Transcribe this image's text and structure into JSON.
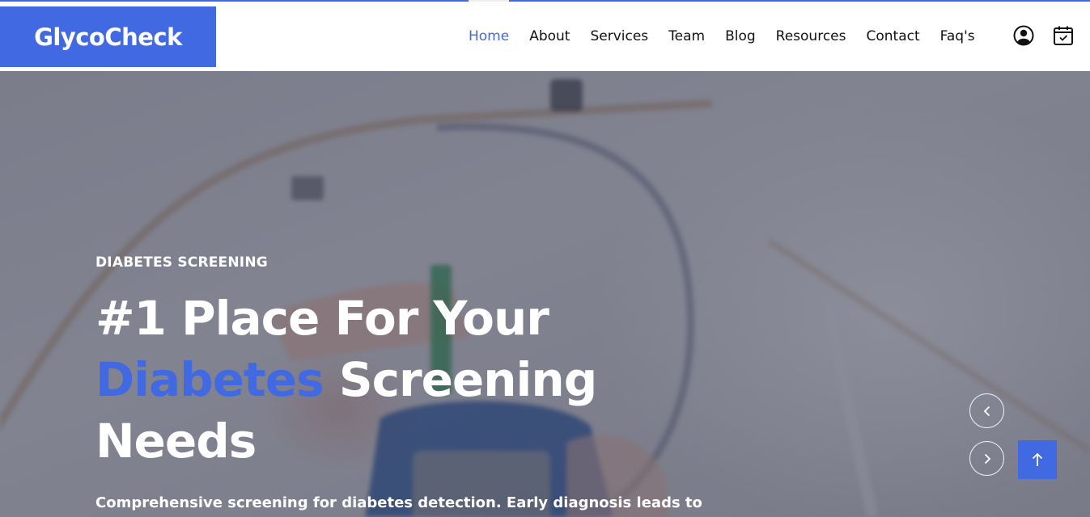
{
  "brand": {
    "name": "GlycoCheck",
    "color": "#4169e1"
  },
  "nav": {
    "items": [
      {
        "label": "Home",
        "active": true
      },
      {
        "label": "About",
        "active": false
      },
      {
        "label": "Services",
        "active": false
      },
      {
        "label": "Team",
        "active": false
      },
      {
        "label": "Blog",
        "active": false
      },
      {
        "label": "Resources",
        "active": false
      },
      {
        "label": "Contact",
        "active": false
      },
      {
        "label": "Faq's",
        "active": false
      }
    ],
    "icons": [
      "user-circle-icon",
      "calendar-check-icon"
    ]
  },
  "hero": {
    "eyebrow": "DIABETES SCREENING",
    "headline_part1": "#1 Place For Your",
    "headline_accent": "Diabetes",
    "headline_part2": "Screening Needs",
    "subtext": "Comprehensive screening for diabetes detection. Early diagnosis leads to",
    "accent_color": "#4169e1"
  },
  "controls": {
    "prev_icon": "chevron-left-icon",
    "next_icon": "chevron-right-icon",
    "to_top_icon": "arrow-up-icon"
  }
}
